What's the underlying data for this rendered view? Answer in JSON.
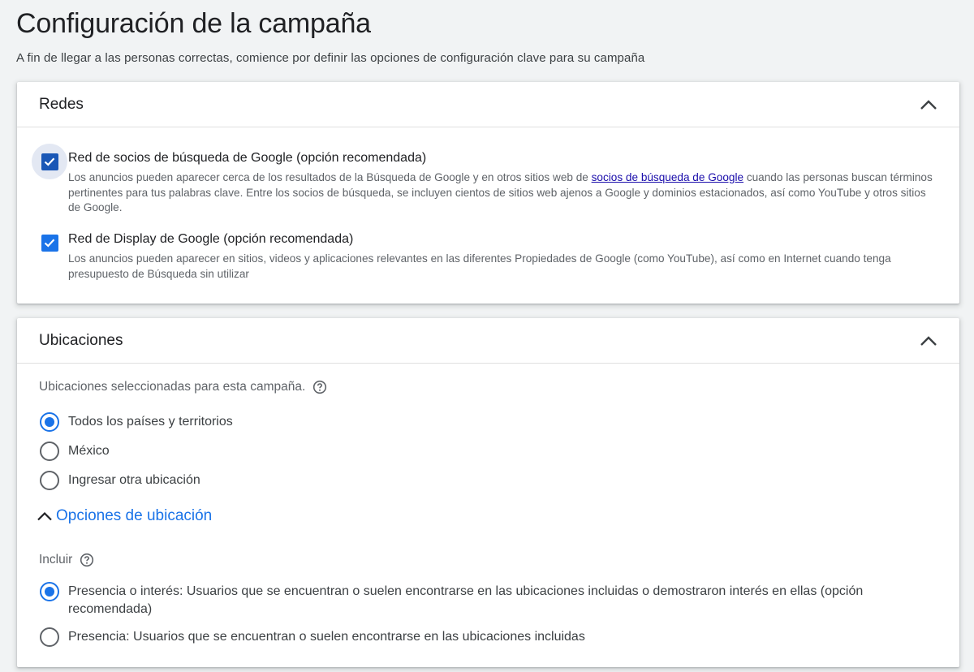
{
  "page": {
    "title": "Configuración de la campaña",
    "subtitle": "A fin de llegar a las personas correctas, comience por definir las opciones de configuración clave para su campaña"
  },
  "networks": {
    "title": "Redes",
    "collapse_icon": "chevron-up-icon",
    "options": [
      {
        "title": "Red de socios de búsqueda de Google (opción recomendada)",
        "checked": true,
        "desc_before": "Los anuncios pueden aparecer cerca de los resultados de la Búsqueda de Google y en otros sitios web de ",
        "desc_link": "socios de búsqueda de Google",
        "desc_after": " cuando las personas buscan términos pertinentes para tus palabras clave. Entre los socios de búsqueda, se incluyen cientos de sitios web ajenos a Google y dominios estacionados, así como YouTube y otros sitios de Google."
      },
      {
        "title": "Red de Display de Google (opción recomendada)",
        "checked": true,
        "desc": "Los anuncios pueden aparecer en sitios, videos y aplicaciones relevantes en las diferentes Propiedades de Google (como YouTube), así como en Internet cuando tenga presupuesto de Búsqueda sin utilizar"
      }
    ]
  },
  "locations": {
    "title": "Ubicaciones",
    "collapse_icon": "chevron-up-icon",
    "selected_label": "Ubicaciones seleccionadas para esta campaña.",
    "options": [
      {
        "label": "Todos los países y territorios",
        "checked": true
      },
      {
        "label": "México",
        "checked": false
      },
      {
        "label": "Ingresar otra ubicación",
        "checked": false
      }
    ],
    "options_toggle": "Opciones de ubicación",
    "include_label": "Incluir",
    "include_options": [
      {
        "label": "Presencia o interés: Usuarios que se encuentran o suelen encontrarse en las ubicaciones incluidas o demostraron interés en ellas (opción recomendada)",
        "checked": true
      },
      {
        "label": "Presencia: Usuarios que se encuentran o suelen encontrarse en las ubicaciones incluidas",
        "checked": false
      }
    ]
  },
  "colors": {
    "accent": "#1a73e8",
    "link": "#1a0dab",
    "background": "#f1f3f4"
  }
}
